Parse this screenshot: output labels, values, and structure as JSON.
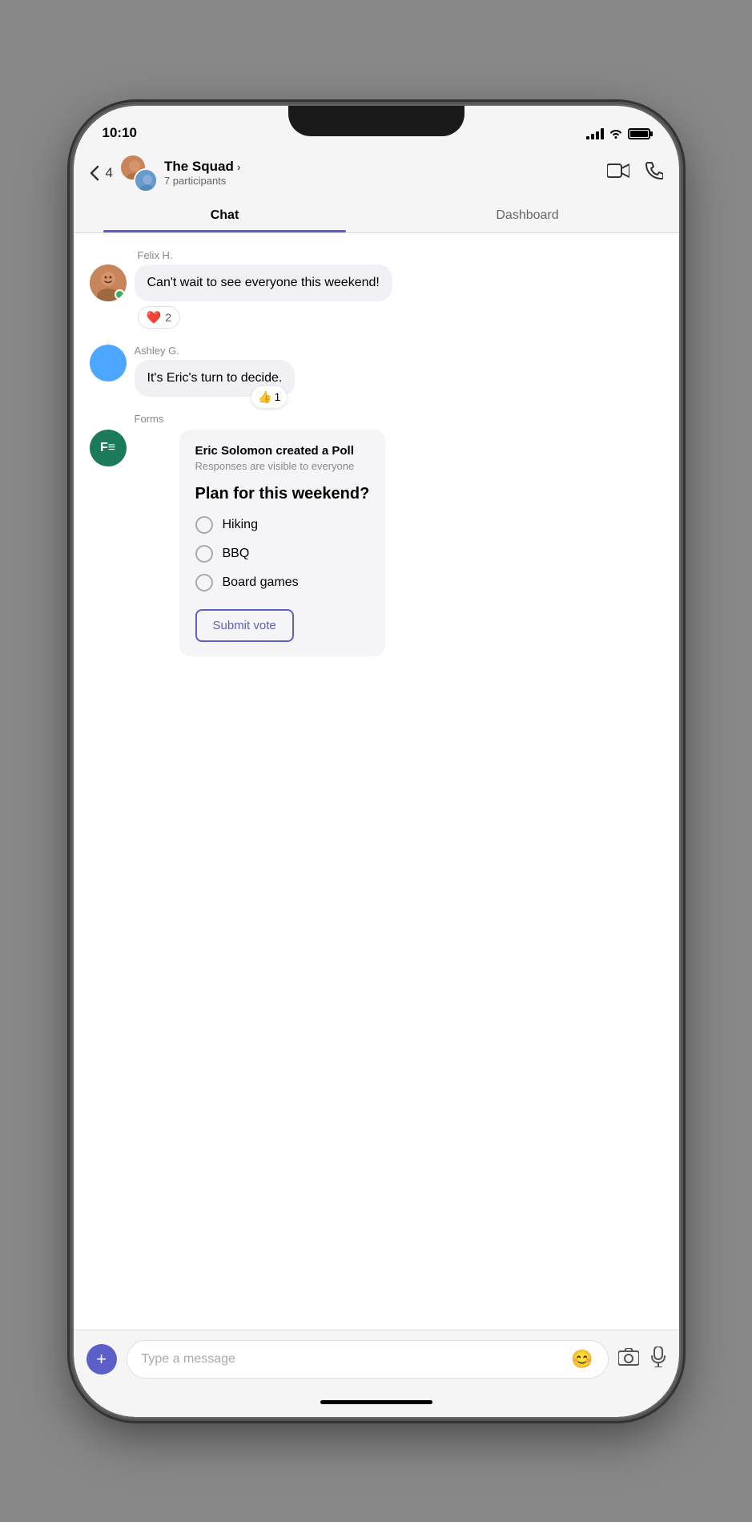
{
  "statusBar": {
    "time": "10:10",
    "icons": {
      "signal": "signal-icon",
      "wifi": "wifi-icon",
      "battery": "battery-icon"
    }
  },
  "header": {
    "backCount": "4",
    "groupName": "The Squad",
    "participantsLabel": "7 participants",
    "videoCallLabel": "video-call",
    "phoneCallLabel": "phone-call"
  },
  "tabs": [
    {
      "label": "Chat",
      "active": true
    },
    {
      "label": "Dashboard",
      "active": false
    }
  ],
  "messages": [
    {
      "senderName": "Felix H.",
      "text": "Can't wait to see everyone this weekend!",
      "reaction": "❤",
      "reactionCount": "2",
      "avatarType": "felix"
    },
    {
      "senderName": "Ashley G.",
      "text": "It's Eric's turn to decide.",
      "reaction": "👍",
      "reactionCount": "1",
      "avatarType": "blue"
    }
  ],
  "poll": {
    "formsLabel": "Forms",
    "creatorText": "Eric Solomon created a Poll",
    "subtitle": "Responses are visible to everyone",
    "question": "Plan for this weekend?",
    "options": [
      "Hiking",
      "BBQ",
      "Board games"
    ],
    "submitLabel": "Submit vote"
  },
  "inputBar": {
    "placeholder": "Type a message",
    "addIcon": "+",
    "emojiIcon": "😊",
    "cameraIcon": "📷",
    "micIcon": "🎤"
  }
}
